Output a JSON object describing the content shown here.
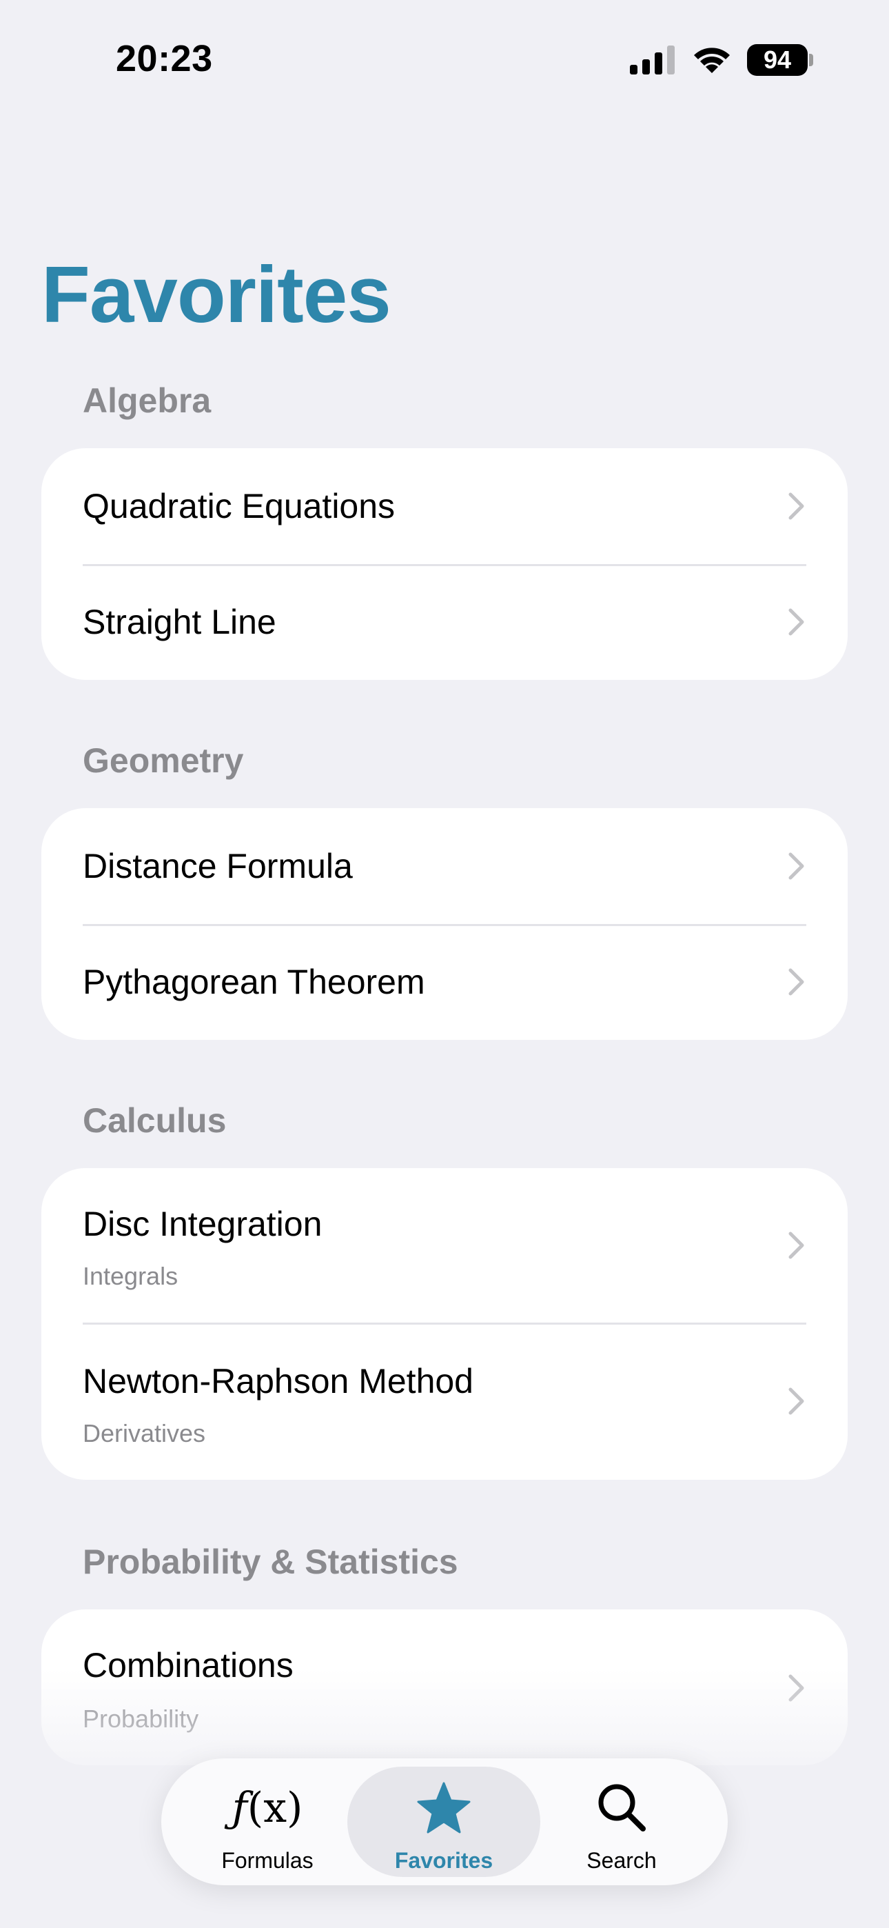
{
  "status_bar": {
    "time": "20:23",
    "battery": "94",
    "icons": [
      "cellular-signal-icon",
      "wifi-icon",
      "battery-icon"
    ]
  },
  "page": {
    "title": "Favorites"
  },
  "sections": [
    {
      "header": "Algebra",
      "items": [
        {
          "title": "Quadratic Equations"
        },
        {
          "title": "Straight Line"
        }
      ]
    },
    {
      "header": "Geometry",
      "items": [
        {
          "title": "Distance Formula"
        },
        {
          "title": "Pythagorean Theorem"
        }
      ]
    },
    {
      "header": "Calculus",
      "items": [
        {
          "title": "Disc Integration",
          "subtitle": "Integrals"
        },
        {
          "title": "Newton-Raphson Method",
          "subtitle": "Derivatives"
        }
      ]
    },
    {
      "header": "Probability & Statistics",
      "items": [
        {
          "title": "Combinations",
          "subtitle": "Probability"
        }
      ]
    }
  ],
  "tab_bar": {
    "tabs": [
      {
        "label": "Formulas",
        "icon": "function-icon",
        "icon_text_f": "ƒ",
        "icon_text_x": "(x)"
      },
      {
        "label": "Favorites",
        "icon": "star-icon",
        "active": true
      },
      {
        "label": "Search",
        "icon": "search-icon"
      }
    ]
  },
  "colors": {
    "accent": "#2E86AB",
    "background": "#F0F0F5",
    "card": "#FFFFFF",
    "secondary_text": "#8A8A8E"
  }
}
